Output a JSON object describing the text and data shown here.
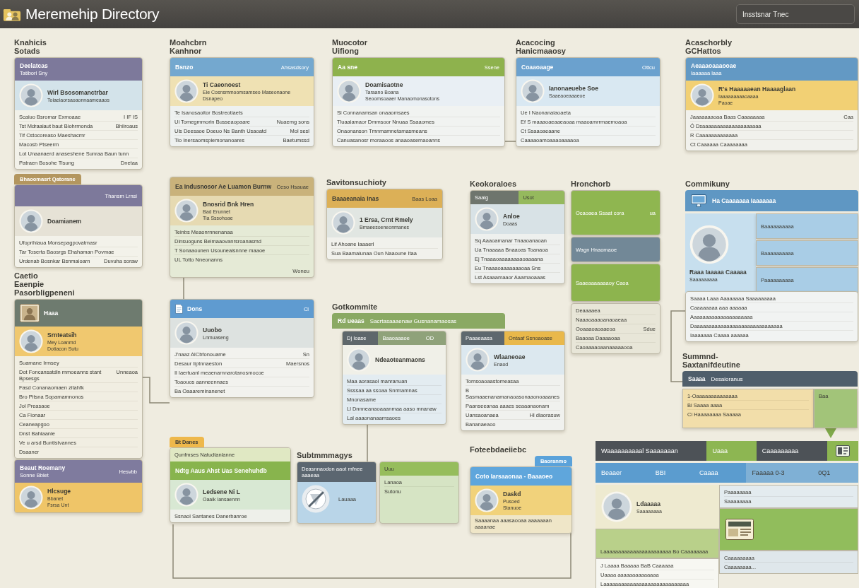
{
  "app_bar": {
    "title": "Meremehip Directory",
    "search": {
      "value": "Insstsnar Tnec"
    }
  },
  "sections": [
    {
      "heading": "Knahicis\nSotads",
      "columns": [
        [
          {
            "color": "#f2f1e9",
            "header": {
              "title": "Deelatcas",
              "subtitle": "Tatiborl Sny",
              "color": "#7d799b"
            },
            "person": {
              "name": "Wirl Bsosomanctrbar",
              "detail": "Toiaeiaorsaoaonnaameaaos",
              "color": "#d3e3ea"
            },
            "lines": [
              {
                "text": "Scaiuo Bsromar Exmoaae",
                "meta": "I IF IS"
              },
              {
                "text": "Tst Mdraaiaut baut Biohrmonda",
                "meta": "Bhiiroaus"
              },
              {
                "text": "Tif Cstocoreaso Maeshacmr"
              },
              {
                "text": "Macosb Ptseerm"
              },
              {
                "text": "Lot Unaanaerd anaseshene Sunraa Baun tunn"
              },
              {
                "text": "Patraen Bosohe Tisung",
                "meta": "Dnetaa"
              }
            ]
          }
        ]
      ]
    },
    {
      "columns": [
        [
          {
            "color": "#f3f2ea",
            "tag": {
              "text": "Bhaoomasrt Qatorane",
              "color": "#b3965f"
            },
            "header": {
              "meta": "Thansm Lrnsi",
              "color": "#7d799b"
            },
            "person": {
              "name": "Doamianem",
              "color": "#e6e2d6"
            },
            "lines": [
              {
                "text": "Ufoprihiaua Monsepagpovatmasr"
              },
              {
                "text": "Tar Toserta Baosrgs Ehahaman Povmae"
              },
              {
                "text": "Urdenab Bosnkar Bsnmaioarn",
                "meta": "Duvuha soraw"
              }
            ]
          }
        ]
      ]
    },
    {
      "heading": "Caetio\nEaenpie\nPasorbligpeneni",
      "columns": [
        [
          {
            "color": "#f1eee2",
            "header": {
              "icon": {
                "kind": "photo"
              },
              "title": "Haaa",
              "color": "#6e7b6f"
            },
            "person": {
              "name": "Srnteatsih",
              "detail": "Mey Loanmd",
              "note": "Dotiacon Sutu",
              "color": "#f0c86f"
            },
            "lines": [
              {
                "text": "Suamane Irmsey"
              },
              {
                "text": "Dot Foncansatdin mmoeanns stant Bpsesgs",
                "meta": "Unneaoa"
              },
              {
                "text": "Fasd Conanaomaen zitahfk"
              },
              {
                "text": "Bro Pitsna Sopamamnonos"
              },
              {
                "text": "Jol Preasaoe"
              },
              {
                "text": "Ca Fionaar"
              },
              {
                "text": "Ceaneapgoo"
              },
              {
                "text": "Dnst Bahiaanie"
              },
              {
                "text": "Ve u arsd Buntistvannes"
              },
              {
                "text": "Dsaaner"
              }
            ]
          }
        ]
      ]
    },
    {
      "columns": [
        [
          {
            "color": "#f2d68c",
            "header": {
              "title": "Beaut Roemany",
              "subtitle": "Sonne Bblet",
              "meta": "Hesvbb",
              "color": "#7f7b9e"
            },
            "person": {
              "name": "Hlcsuge",
              "detail": "Bbanet",
              "note": "Fsrsa Unt",
              "color": "#efc568"
            }
          }
        ]
      ]
    },
    {
      "heading": "Moahcbrn\nKanhnor",
      "columns": [
        [
          {
            "color": "#eef1f0",
            "header": {
              "title": "Bsnzo",
              "meta": "Ahsasdsory",
              "color": "#74a8cf"
            },
            "person": {
              "name": "Ti Caeonoest",
              "detail": "Eie Cosnsmmoomsamseo Maseonaone",
              "note": "Dsnapeo",
              "color": "#efe1b3"
            },
            "lines": [
              {
                "text": "Te Isanosaoitor Bostreotiaets"
              },
              {
                "text": "Ui Tomegmmorin Busseaopaare",
                "meta": "Nuaemg sons"
              },
              {
                "text": "Uls Deesaoe Doeuo Ns Banth Usaoatd",
                "meta": "Mol sesl"
              },
              {
                "text": "Tio Inersaomspiemonanoares",
                "meta": "Baetumssd"
              }
            ]
          }
        ]
      ]
    },
    {
      "columns": [
        [
          {
            "color": "#e5ead6",
            "header": {
              "title": "Ea Indusnosor Ae Luamon Burnw",
              "meta": "Ceso Hsauae",
              "color": "#c9b27b"
            },
            "person": {
              "name": "Bnosrid Bnk Hren",
              "detail": "Bad Erunnet",
              "note": "Tia Sssohoae",
              "color": "#e6dab2"
            },
            "lines": [
              {
                "text": "Teinbs Meaonrnnenanaa"
              },
              {
                "text": "Dinsuoguns Beimaaovanrsroanasmd"
              },
              {
                "text": "T Sonaaounen Usouneaisnnne maaoe"
              },
              {
                "text": "UL Totto Nneonanns"
              }
            ],
            "footer": "Woneu"
          }
        ]
      ]
    },
    {
      "columns": [
        [
          {
            "color": "#f2f2ee",
            "header": {
              "icon": {
                "kind": "document"
              },
              "title": "Dons",
              "meta": "Cl",
              "color": "#5f9bd0"
            },
            "person": {
              "name": "Uuobo",
              "detail": "Lnmuaseng",
              "color": "#dde2e0"
            },
            "lines": [
              {
                "text": "J'naaz AlCbfonouame",
                "meta": "Sn"
              },
              {
                "text": "Desaur Iiptnnaeston",
                "meta": "Maersnos"
              },
              {
                "text": "Il Iaertuanl meaenarnnarotanosmocoe"
              },
              {
                "text": "Toaouos aanneennaes"
              },
              {
                "text": "Ba Oaaareminanenet"
              }
            ]
          }
        ]
      ]
    },
    {
      "columns": [
        [
          {
            "color": "#eef0ea",
            "tag": {
              "text": "Bt Danes",
              "color": "#eeb84b"
            },
            "bands": [
              {
                "text": "Qunfmses Natudtanlanne",
                "color": "#e0e8c3"
              }
            ],
            "header": {
              "title": "Ndtg Aaus Ahst Uas Senehuhdb",
              "color": "#88b44d"
            },
            "person": {
              "name": "Ledsene Ni L",
              "detail": "Oaaik Iansaennn",
              "color": "#d8e8d3"
            },
            "lines": [
              {
                "text": "Ssnaol Santanes Danerbanroe"
              }
            ]
          }
        ]
      ]
    },
    {
      "heading": "Muocotor\nUifiong",
      "columns": [
        [
          {
            "color": "#f1f3f1",
            "header": {
              "title": "Aa sne",
              "meta": "Ssene",
              "color": "#8eb24d"
            },
            "person": {
              "name": "Doamisaotne",
              "detail": "Taraano Boana",
              "note": "Seoomsoaaer Manaomonasotons",
              "color": "#e9eff4"
            },
            "lines": [
              {
                "text": "Sl Connanamsan onaaomsaes"
              },
              {
                "text": "Tluaaiamaor Dmmsoor Nnuaa Ssaaomes"
              },
              {
                "text": "Onaonanson Tmnmamnetamasmeans"
              },
              {
                "text": "Canuasanosr moraaoos anaaoasemaoanns"
              }
            ]
          }
        ]
      ]
    },
    {
      "heading": "Savitonsuchioty",
      "columns": [
        [
          {
            "color": "#f1f1ec",
            "header": {
              "title": "Baaaeanaia Inas",
              "meta": "Baas Loaa",
              "color": "#dcb057"
            },
            "person": {
              "name": "1 Ersa, Crnt Rmely",
              "detail": "Bmaeesoeneonmanes",
              "color": "#e1e6e2"
            },
            "lines": [
              {
                "text": "Lif Ahoane Iaaaerl"
              },
              {
                "text": "Sua Baamaiunaa Oun Naaoune Itaa"
              }
            ]
          }
        ]
      ]
    },
    {
      "heading": "Gotkommite",
      "banner": {
        "title": "Rd ueaas",
        "meta": "Sacrtasaaaenaw Gusnanamaosas",
        "color": "#8aa963"
      },
      "columns": [
        [
          {
            "color": "#e3ecf1",
            "bands": [
              {
                "text": "Dj Ioase",
                "color": "#5e676b"
              },
              {
                "text": "Baaoaaaoe",
                "color": "#8fa27a"
              },
              {
                "text": "OD",
                "color": "#8fa27a"
              }
            ],
            "person": {
              "name": "Ndeaoteanmaons",
              "color": "#f0f0e8"
            },
            "lines": [
              {
                "text": "Maa aorasaol manranuan"
              },
              {
                "text": "Ssssaa aa ssoaa Snrmamnas"
              },
              {
                "text": "Mnonasame"
              },
              {
                "text": "Ll Dnnneanaoaaanmaa aaso mnanaw"
              },
              {
                "text": "Lal aaaonanaamsaoes"
              }
            ]
          }
        ],
        [
          {
            "color": "#f0f1ee",
            "bands": [
              {
                "text": "Paaaeaasa",
                "color": "#5e686e"
              },
              {
                "text": "Ontaaf Ssnoaoase",
                "color": "#e9b84b"
              }
            ],
            "person": {
              "name": "Wlaaneoae",
              "detail": "Enaod",
              "color": "#dce8ef"
            },
            "lines": [
              {
                "text": "Tomsoaoaastomeasaa"
              },
              {
                "text": "B Sasmaaenanamanaoasonaaonoaaanes"
              },
              {
                "text": "Paanseeanaa aaaes seaaanaonam"
              },
              {
                "text": "Uansaoanaea",
                "meta": "Hl dlaorasuw"
              },
              {
                "text": "Bananaeaoo"
              }
            ]
          }
        ]
      ]
    },
    {
      "heading": "Subtmmmagys",
      "columns": [
        [
          {
            "color": "#b9d5e8",
            "bands": [
              {
                "text": "Deasnnaodon aaot mfnee aaaeaa",
                "color": "#5b6670"
              }
            ],
            "emblem": {
              "kind": "badge"
            },
            "lines": [
              {
                "text": "Lauaaa"
              }
            ]
          }
        ],
        [
          {
            "color": "#d6e4c4",
            "bands": [
              {
                "text": "Uuu",
                "color": "#96bd5c"
              }
            ],
            "lines": [
              {
                "text": "Lanaoa"
              },
              {
                "text": "Sutonu"
              }
            ]
          }
        ]
      ]
    },
    {
      "heading": "Acacocing\nHanicmaaosy",
      "columns": [
        [
          {
            "color": "#f0f3f2",
            "header": {
              "title": "Coaaoaage",
              "meta": "Ottcu",
              "color": "#6ba1ce"
            },
            "person": {
              "name": "Ianonaeuebe Soe",
              "detail": "Saaeaoeaaaeoe",
              "color": "#d9e8f2"
            },
            "lines": [
              {
                "text": "Ue I Naonanaiaoaeta"
              },
              {
                "text": "Ef S maaaoaeaaeaoaa maaoamrrmaemoaoa"
              },
              {
                "text": "Ct Ssaaoaeaane"
              },
              {
                "text": "Caaaaoamoaaaoaaaaoa"
              }
            ]
          }
        ]
      ]
    },
    {
      "heading": "Keokoraloes",
      "columns": [
        [
          {
            "color": "#eef0ee",
            "bands": [
              {
                "text": "Saaig",
                "color": "#6e756d"
              },
              {
                "text": "Usot",
                "color": "#95b95d"
              }
            ],
            "person": {
              "name": "Anloe",
              "detail": "Doaas",
              "color": "#d8e2e6"
            },
            "lines": [
              {
                "text": "Sq Aaaoamanar Tnaaoanaoan"
              },
              {
                "text": "Ua Tnaaaaa Bnaaoas Toanaoa"
              },
              {
                "text": "Ej Tnaaaoaaaaaaaaoaaaana"
              },
              {
                "text": "Eu Tnaaaoaaaaaaaoaa Sns"
              },
              {
                "text": "Lst Asaaamaaor Aaamaoaaas"
              }
            ]
          }
        ]
      ]
    },
    {
      "heading": "Hronchorb",
      "columns": [
        [
          {
            "color": "#8fb650",
            "lines": [
              {
                "text": "Ocaoaea Ssaat cora",
                "meta": "ua"
              }
            ]
          },
          {
            "color": "#728897",
            "lines": [
              {
                "text": "Wagn Hnaomaoe"
              }
            ]
          },
          {
            "color": "#8db44e",
            "lines": [
              {
                "text": "Saaeaaaaaaaoy Caoa"
              }
            ]
          },
          {
            "color": "#e8e6d8",
            "lines": [
              {
                "text": "Deaaaaea"
              },
              {
                "text": "Naaaoaaaoanaoaeaa"
              },
              {
                "text": "Ooaaaoaoaaeoa",
                "meta": "Sdue"
              },
              {
                "text": "Baaoaa Daaaaoaa"
              },
              {
                "text": "Caoaaaaoaanaaaaaooa"
              }
            ]
          }
        ]
      ]
    },
    {
      "heading": "Foteebdaeiiebc",
      "columns": [
        [
          {
            "color": "#efe6c8",
            "tag": {
              "text": "Baoranmo",
              "color": "#5aa2da"
            },
            "header": {
              "title": "Coto Iarsaaonaa - Baaaoeo",
              "color": "#5fa6dc"
            },
            "person": {
              "name": "Daskd",
              "detail": "Pusoed",
              "note": "Stanuoe",
              "color": "#f1d27b"
            },
            "footer": "Saaaanaa aaasaooaa aaaaaaan aaaanae"
          }
        ]
      ]
    },
    {
      "heading": "Acaschorbly\nGCHattos",
      "columns": [
        [
          {
            "color": "#f1f1ec",
            "header": {
              "title": "Aeaaaoaaaooae",
              "subtitle": "Iaaaaaa laaa",
              "color": "#6399c4"
            },
            "person": {
              "name": "R's Haaaaaean Haaaaglaan",
              "detail": "Iaaaaaaaaaoaaaa",
              "note": "Paoae",
              "color": "#f2d074"
            },
            "lines": [
              {
                "text": "Jaaaaaaaoaa Baas Caaaaaaaa",
                "meta": "Caa"
              },
              {
                "text": "Ó Dsaaaaaaaaaaaaaaaaaaaa"
              },
              {
                "text": "R Caaaaaaaaaaaaa"
              },
              {
                "text": "Ct Caaaaaa Caaaaaaaa"
              }
            ]
          }
        ]
      ]
    },
    {
      "heading": "Commikuny",
      "banner": {
        "icon": {
          "kind": "monitor"
        },
        "title": "Ha Caaaaaaa Iaaaaaaa",
        "color": "#5f97c3"
      },
      "columns": [
        [
          {
            "person": {
              "name": "Raaa Iaaaaa Caaaaa",
              "detail": "Saaaaaaaaa",
              "color": "#c7dfee"
            }
          }
        ],
        [
          {
            "color": "#a9cde6",
            "lines": [
              {
                "text": "Baaaaaaaaaa"
              }
            ]
          },
          {
            "color": "#a9cde6",
            "lines": [
              {
                "text": "Baaaaaaaaaa"
              }
            ]
          },
          {
            "color": "#a9cde6",
            "lines": [
              {
                "text": "Paaaaaaaaaa"
              }
            ]
          }
        ]
      ]
    },
    {
      "columns": [
        [
          {
            "color": "#f1f3f2",
            "lines": [
              {
                "text": "Saaaa Laaa Aaaaaaaa Saaaaaaaaa"
              },
              {
                "text": "Caaaaaaaa aaa aaaaaa"
              },
              {
                "text": "Aaaaaaaaaaaaaaaaaaaaa"
              },
              {
                "text": "Daaaaaaaaaaaaaaaaaaaaaaaaaaaaaa"
              },
              {
                "text": "Iaaaaaaa Caaaa aaaaaa"
              }
            ]
          }
        ]
      ]
    },
    {
      "heading": "Summnd-\nSaxtanifdeutine",
      "banner": {
        "title": "Saaaa",
        "meta": "Desaioranus",
        "color": "#4f5e6b"
      },
      "columns": [
        [
          {
            "color": "#f2deaa",
            "lines": [
              {
                "text": "1-Oaaaaaaaaaaaaaa"
              },
              {
                "text": "Bi Saaaa aaaa"
              },
              {
                "text": "Ci Haaaaaaaa Saaaaa"
              }
            ]
          }
        ],
        [
          {
            "color": "#a2c479",
            "lines": [
              {
                "text": "Baa"
              }
            ]
          }
        ]
      ]
    },
    {
      "bars": [
        [
          {
            "kind": "text",
            "text": "Waaaaaaaaaal Saaaaaaan",
            "color": "#4d5257"
          },
          {
            "kind": "text",
            "text": "Uaaa",
            "color": "#8db652"
          },
          {
            "kind": "text",
            "text": "Caaaaaaaaa",
            "color": "#4d5257"
          },
          {
            "kind": "icon",
            "color": "#8db652"
          }
        ],
        [
          {
            "text": "Beaaer",
            "color": "#5b9ccf"
          },
          {
            "text": "BBI",
            "color": "#5b9ccf"
          },
          {
            "text": "Caaaa",
            "color": "#5b9ccf"
          },
          {
            "text": "Faaaaa 0-3",
            "color": "#7fb0d5"
          },
          {
            "text": "0Q1",
            "color": "#7fb0d5"
          }
        ]
      ],
      "columns": [
        [
          {
            "person": {
              "name": "Ldaaaaa",
              "detail": "Saaaaaaaa",
              "color": "#eeead0"
            }
          },
          {
            "color": "#b9d08a",
            "lines": [
              {
                "text": "Laaaaaaaaaaaaaaaaaaaaaaa Bo Caaaaaaaa"
              }
            ]
          },
          {
            "color": "#f7f7f2",
            "lines": [
              {
                "text": "J Laaaa Baaaaa BaB Caaaaaa"
              },
              {
                "text": "Uaaaa aaaaaaaaaaaaaa"
              },
              {
                "text": "Laaaaaaaaaaaaaaaaaaaaaaaaaaaaa"
              }
            ]
          }
        ],
        [
          {
            "color": "#e3ebef",
            "lines": [
              {
                "text": "Paaaaaaaa"
              },
              {
                "text": "Saaaaaaaa"
              }
            ]
          },
          {
            "color": "#91bd5c",
            "emblem": {
              "kind": "newspaper"
            }
          },
          {
            "color": "#dfe7eb",
            "lines": [
              {
                "text": "Caaaaaaaaa"
              },
              {
                "text": "Caaaaaaaa..."
              }
            ]
          }
        ]
      ]
    }
  ]
}
